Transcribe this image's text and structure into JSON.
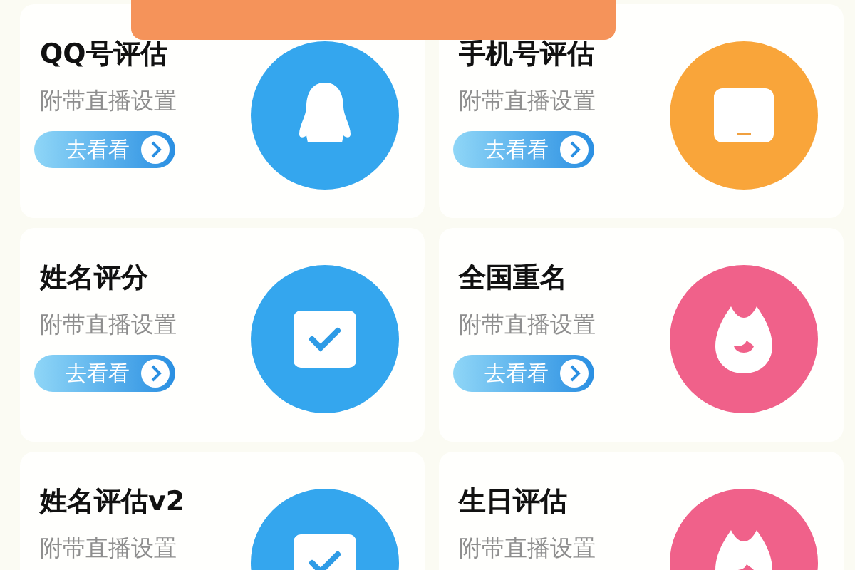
{
  "cards": [
    {
      "title": "QQ号评估",
      "subtitle": "附带直播设置",
      "button": "去看看",
      "kind": "penguin",
      "color": "#34a6ee"
    },
    {
      "title": "手机号评估",
      "subtitle": "附带直播设置",
      "button": "去看看",
      "kind": "screen",
      "color": "#f9a53a"
    },
    {
      "title": "姓名评分",
      "subtitle": "附带直播设置",
      "button": "去看看",
      "kind": "check",
      "color": "#34a6ee"
    },
    {
      "title": "全国重名",
      "subtitle": "附带直播设置",
      "button": "去看看",
      "kind": "flame",
      "color": "#f0618a"
    },
    {
      "title": "姓名评估v2",
      "subtitle": "附带直播设置",
      "kind": "check",
      "color": "#34a6ee"
    },
    {
      "title": "生日评估",
      "subtitle": "附带直播设置",
      "kind": "flame",
      "color": "#f0618a"
    }
  ]
}
